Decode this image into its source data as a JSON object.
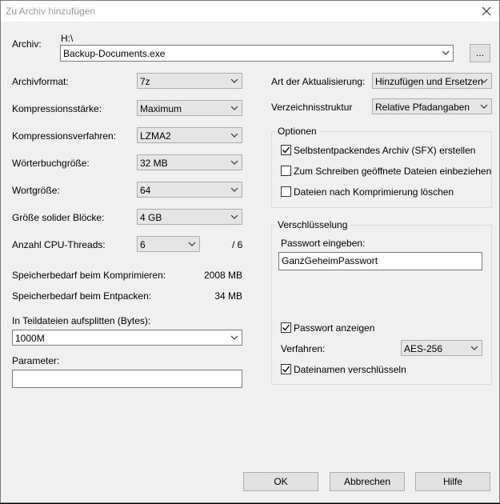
{
  "window": {
    "title": "Zu Archiv hinzufügen"
  },
  "archive": {
    "label": "Archiv:",
    "path": "H:\\",
    "filename": "Backup-Documents.exe",
    "browse_label": "..."
  },
  "left": {
    "format": {
      "label": "Archivformat:",
      "value": "7z"
    },
    "level": {
      "label": "Kompressionsstärke:",
      "value": "Maximum"
    },
    "method": {
      "label": "Kompressionsverfahren:",
      "value": "LZMA2"
    },
    "dict": {
      "label": "Wörterbuchgröße:",
      "value": "32 MB"
    },
    "word": {
      "label": "Wortgröße:",
      "value": "64"
    },
    "solid": {
      "label": "Größe solider Blöcke:",
      "value": "4 GB"
    },
    "threads": {
      "label": "Anzahl CPU-Threads:",
      "value": "6",
      "total": "/ 6"
    },
    "mem_compress": {
      "label": "Speicherbedarf beim Komprimieren:",
      "value": "2008 MB"
    },
    "mem_decompress": {
      "label": "Speicherbedarf beim Entpacken:",
      "value": "34 MB"
    },
    "split": {
      "label": "In Teildateien aufsplitten (Bytes):",
      "value": "1000M"
    },
    "params": {
      "label": "Parameter:",
      "value": ""
    }
  },
  "right": {
    "update": {
      "label": "Art der Aktualisierung:",
      "value": "Hinzufügen und Ersetzen"
    },
    "paths": {
      "label": "Verzeichnisstruktur",
      "value": "Relative Pfadangaben"
    },
    "options": {
      "title": "Optionen",
      "sfx": {
        "label": "Selbstentpackendes Archiv (SFX) erstellen",
        "checked": true
      },
      "shared": {
        "label": "Zum Schreiben geöffnete Dateien einbeziehen",
        "checked": false
      },
      "delete": {
        "label": "Dateien nach Komprimierung löschen",
        "checked": false
      }
    },
    "encryption": {
      "title": "Verschlüsselung",
      "password_label": "Passwort eingeben:",
      "password_value": "GanzGeheimPasswort",
      "show_password": {
        "label": "Passwort anzeigen",
        "checked": true
      },
      "method_label": "Verfahren:",
      "method_value": "AES-256",
      "encrypt_names": {
        "label": "Dateinamen verschlüsseln",
        "checked": true
      }
    }
  },
  "buttons": {
    "ok": "OK",
    "cancel": "Abbrechen",
    "help": "Hilfe"
  }
}
